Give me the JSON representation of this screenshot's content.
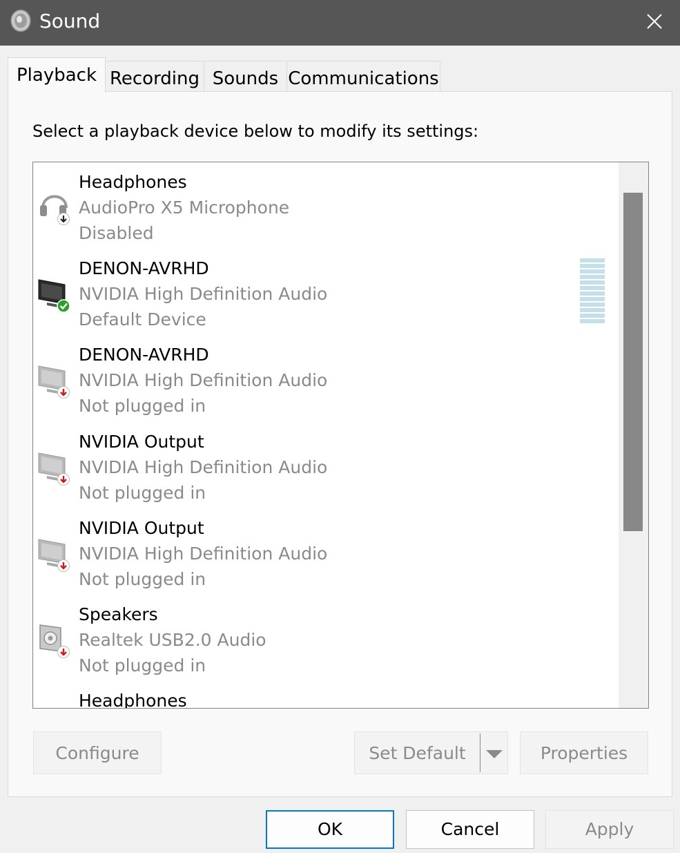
{
  "window": {
    "title": "Sound",
    "title_icon": "speaker-icon",
    "close_icon": "close-icon"
  },
  "tabs": [
    {
      "label": "Playback",
      "active": true
    },
    {
      "label": "Recording",
      "active": false
    },
    {
      "label": "Sounds",
      "active": false
    },
    {
      "label": "Communications",
      "active": false
    }
  ],
  "instruction": "Select a playback device below to modify its settings:",
  "devices": [
    {
      "name": "Headphones",
      "driver": "AudioPro X5 Microphone",
      "status": "Disabled",
      "icon": "headphones-disabled-icon"
    },
    {
      "name": "DENON-AVRHD",
      "driver": "NVIDIA High Definition Audio",
      "status": "Default Device",
      "icon": "monitor-default-icon"
    },
    {
      "name": "DENON-AVRHD",
      "driver": "NVIDIA High Definition Audio",
      "status": "Not plugged in",
      "icon": "monitor-unplugged-icon"
    },
    {
      "name": "NVIDIA Output",
      "driver": "NVIDIA High Definition Audio",
      "status": "Not plugged in",
      "icon": "monitor-unplugged-icon"
    },
    {
      "name": "NVIDIA Output",
      "driver": "NVIDIA High Definition Audio",
      "status": "Not plugged in",
      "icon": "monitor-unplugged-icon"
    },
    {
      "name": "Speakers",
      "driver": "Realtek USB2.0 Audio",
      "status": "Not plugged in",
      "icon": "speaker-unplugged-icon"
    },
    {
      "name": "Headphones",
      "driver": "",
      "status": "",
      "icon": ""
    }
  ],
  "buttons": {
    "configure": "Configure",
    "set_default": "Set Default",
    "properties": "Properties",
    "ok": "OK",
    "cancel": "Cancel",
    "apply": "Apply"
  },
  "colors": {
    "titlebar": "#565656",
    "accent": "#0078d4",
    "default_check": "#2ba02b",
    "unplugged_arrow": "#d11b1b",
    "meter": "#c5dfe8"
  }
}
